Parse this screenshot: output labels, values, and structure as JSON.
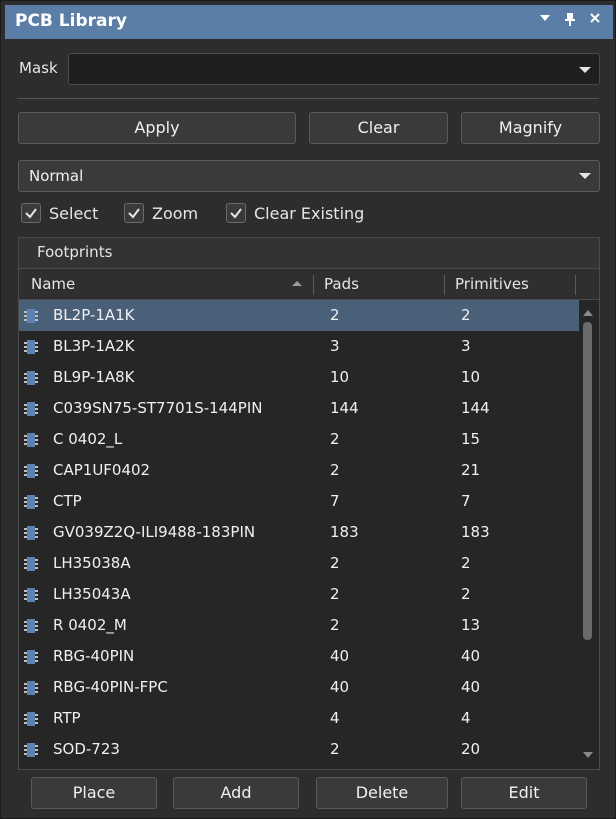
{
  "panel": {
    "title": "PCB Library"
  },
  "titlebar_icons": [
    "dropdown-icon",
    "pin-icon",
    "close-icon"
  ],
  "mask": {
    "label": "Mask",
    "value": ""
  },
  "buttons": {
    "apply": "Apply",
    "clear": "Clear",
    "magnify": "Magnify"
  },
  "mode_select": {
    "value": "Normal"
  },
  "options": {
    "select": "Select",
    "zoom": "Zoom",
    "clear_existing": "Clear Existing"
  },
  "footprints": {
    "title": "Footprints",
    "columns": {
      "name": "Name",
      "pads": "Pads",
      "primitives": "Primitives"
    },
    "rows": [
      {
        "name": "BL2P-1A1K",
        "pads": "2",
        "primitives": "2",
        "selected": true
      },
      {
        "name": "BL3P-1A2K",
        "pads": "3",
        "primitives": "3"
      },
      {
        "name": "BL9P-1A8K",
        "pads": "10",
        "primitives": "10"
      },
      {
        "name": "C039SN75-ST7701S-144PIN",
        "pads": "144",
        "primitives": "144"
      },
      {
        "name": "C 0402_L",
        "pads": "2",
        "primitives": "15"
      },
      {
        "name": "CAP1UF0402",
        "pads": "2",
        "primitives": "21"
      },
      {
        "name": "CTP",
        "pads": "7",
        "primitives": "7"
      },
      {
        "name": "GV039Z2Q-ILI9488-183PIN",
        "pads": "183",
        "primitives": "183"
      },
      {
        "name": "LH35038A",
        "pads": "2",
        "primitives": "2"
      },
      {
        "name": "LH35043A",
        "pads": "2",
        "primitives": "2"
      },
      {
        "name": "R 0402_M",
        "pads": "2",
        "primitives": "13"
      },
      {
        "name": "RBG-40PIN",
        "pads": "40",
        "primitives": "40"
      },
      {
        "name": "RBG-40PIN-FPC",
        "pads": "40",
        "primitives": "40"
      },
      {
        "name": "RTP",
        "pads": "4",
        "primitives": "4"
      },
      {
        "name": "SOD-723",
        "pads": "2",
        "primitives": "20"
      }
    ]
  },
  "bottom_buttons": {
    "place": "Place",
    "add": "Add",
    "delete": "Delete",
    "edit": "Edit"
  },
  "colors": {
    "titlebar": "#5b7ea6",
    "selection": "#4a5f78",
    "background": "#2d2d2d"
  }
}
